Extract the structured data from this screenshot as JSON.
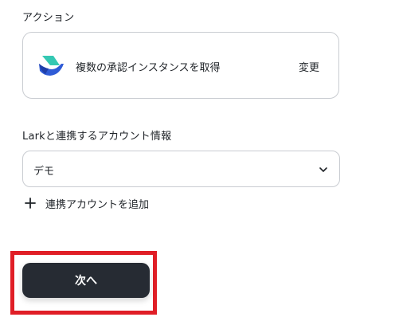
{
  "action_section": {
    "label": "アクション",
    "action_name": "複数の承認インスタンスを取得",
    "change_label": "変更",
    "app_icon": "lark-logo-icon"
  },
  "account_section": {
    "label": "Larkと連携するアカウント情報",
    "selected_account": "デモ",
    "add_account_label": "連携アカウントを追加"
  },
  "footer": {
    "next_label": "次へ"
  },
  "colors": {
    "button_bg": "#262b33",
    "highlight": "#e01e26",
    "border": "#c9ccd1"
  }
}
